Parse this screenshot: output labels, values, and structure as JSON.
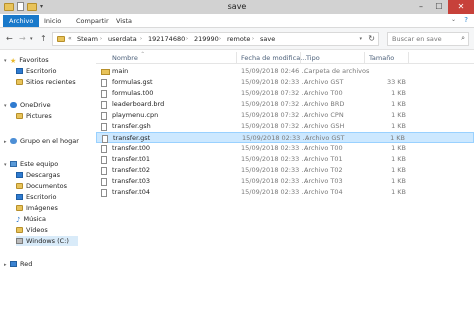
{
  "window": {
    "title": "save",
    "controls": {
      "minimize": "–",
      "maximize": "☐",
      "close": "✕"
    }
  },
  "ribbon": {
    "tabs": [
      "Archivo",
      "Inicio",
      "Compartir",
      "Vista"
    ]
  },
  "address": {
    "crumbs": [
      "Steam",
      "userdata",
      "192174680",
      "219990",
      "remote",
      "save"
    ],
    "search_placeholder": "Buscar en save"
  },
  "navpane": {
    "items": [
      {
        "label": "Favoritos",
        "icon": "star-icon"
      },
      {
        "label": "Escritorio",
        "icon": "desktop-icon"
      },
      {
        "label": "Sitios recientes",
        "icon": "recent-icon"
      },
      {
        "label": "OneDrive",
        "icon": "onedrive-icon"
      },
      {
        "label": "Pictures",
        "icon": "folder-icon"
      },
      {
        "label": "Grupo en el hogar",
        "icon": "homegroup-icon"
      },
      {
        "label": "Este equipo",
        "icon": "computer-icon"
      },
      {
        "label": "Descargas",
        "icon": "downloads-icon"
      },
      {
        "label": "Documentos",
        "icon": "documents-icon"
      },
      {
        "label": "Escritorio",
        "icon": "desktop-icon"
      },
      {
        "label": "Imágenes",
        "icon": "pictures-icon"
      },
      {
        "label": "Música",
        "icon": "music-icon"
      },
      {
        "label": "Vídeos",
        "icon": "videos-icon"
      },
      {
        "label": "Windows (C:)",
        "icon": "drive-icon"
      },
      {
        "label": "Red",
        "icon": "network-icon"
      }
    ]
  },
  "columns": {
    "name": "Nombre",
    "date": "Fecha de modifica...",
    "type": "Tipo",
    "size": "Tamaño"
  },
  "files": [
    {
      "name": "main",
      "date": "15/09/2018 02:46 ...",
      "type": "Carpeta de archivos",
      "size": "",
      "kind": "folder"
    },
    {
      "name": "formulas.gst",
      "date": "15/09/2018 02:33 ...",
      "type": "Archivo GST",
      "size": "33 KB",
      "kind": "file"
    },
    {
      "name": "formulas.t00",
      "date": "15/09/2018 07:32 ...",
      "type": "Archivo T00",
      "size": "1 KB",
      "kind": "file"
    },
    {
      "name": "leaderboard.brd",
      "date": "15/09/2018 07:32 ...",
      "type": "Archivo BRD",
      "size": "1 KB",
      "kind": "file"
    },
    {
      "name": "playmenu.cpn",
      "date": "15/09/2018 07:32 ...",
      "type": "Archivo CPN",
      "size": "1 KB",
      "kind": "file"
    },
    {
      "name": "transfer.gsh",
      "date": "15/09/2018 07:32 ...",
      "type": "Archivo GSH",
      "size": "1 KB",
      "kind": "file"
    },
    {
      "name": "transfer.gst",
      "date": "15/09/2018 02:33 ...",
      "type": "Archivo GST",
      "size": "1 KB",
      "kind": "file",
      "selected": true
    },
    {
      "name": "transfer.t00",
      "date": "15/09/2018 02:33 ...",
      "type": "Archivo T00",
      "size": "1 KB",
      "kind": "file"
    },
    {
      "name": "transfer.t01",
      "date": "15/09/2018 02:33 ...",
      "type": "Archivo T01",
      "size": "1 KB",
      "kind": "file"
    },
    {
      "name": "transfer.t02",
      "date": "15/09/2018 02:33 ...",
      "type": "Archivo T02",
      "size": "1 KB",
      "kind": "file"
    },
    {
      "name": "transfer.t03",
      "date": "15/09/2018 02:33 ...",
      "type": "Archivo T03",
      "size": "1 KB",
      "kind": "file"
    },
    {
      "name": "transfer.t04",
      "date": "15/09/2018 02:33 ...",
      "type": "Archivo T04",
      "size": "1 KB",
      "kind": "file"
    }
  ]
}
